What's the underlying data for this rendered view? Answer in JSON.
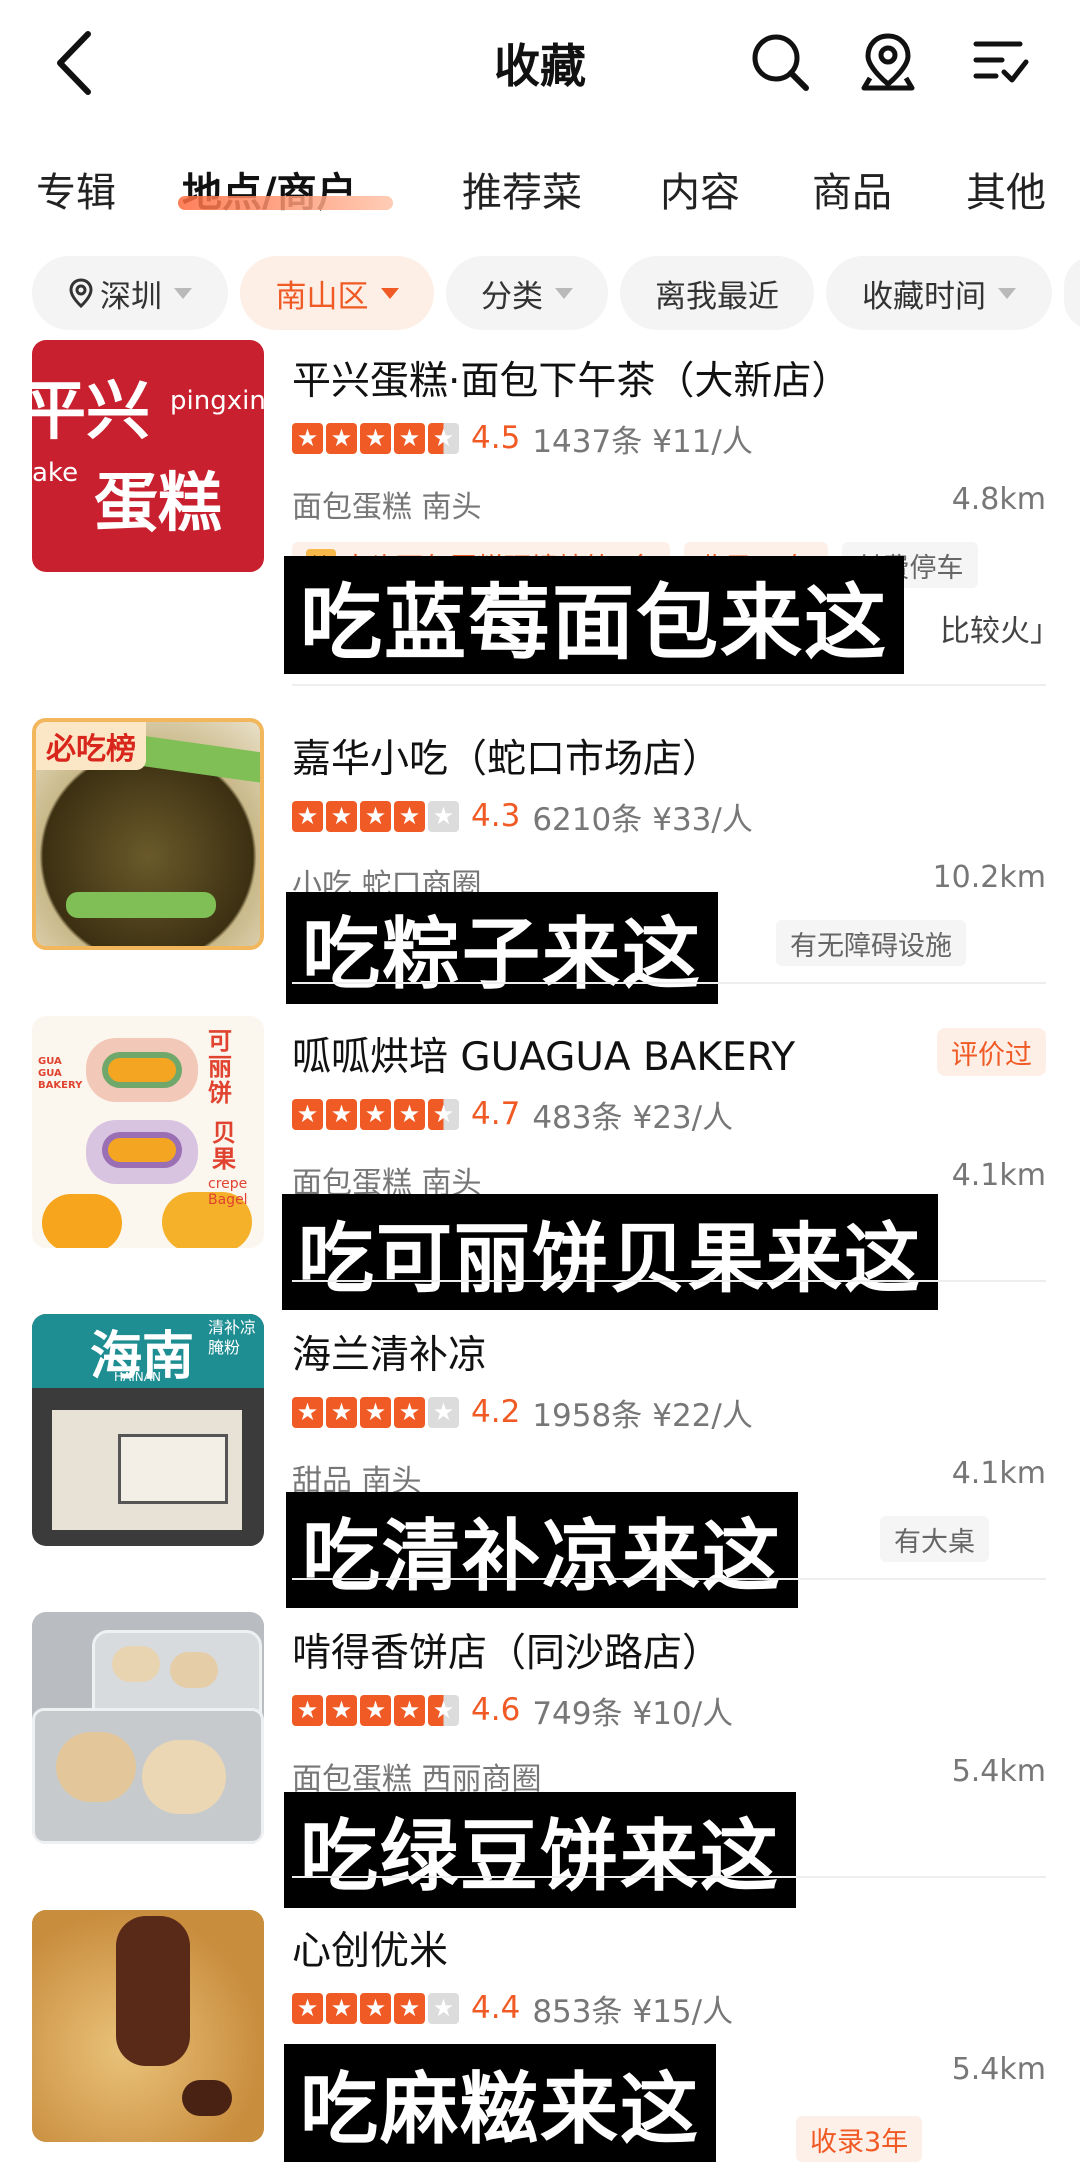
{
  "header": {
    "title": "收藏"
  },
  "tabs": [
    "专辑",
    "地点/商户",
    "推荐菜",
    "内容",
    "商品",
    "其他"
  ],
  "filters": [
    "深圳",
    "南山区",
    "分类",
    "离我最近",
    "收藏时间"
  ],
  "colors": {
    "accent": "#f05a24",
    "overlay": "#000000"
  },
  "items": [
    {
      "name": "平兴蛋糕·面包下午茶（大新店）",
      "rating": 4.5,
      "score": "4.5",
      "reviews": "1437条",
      "price": "¥11/人",
      "category": "面包蛋糕 南头",
      "distance": "4.8km",
      "tags": [
        "南头面包蛋糕环境榜第3名",
        "收录12年",
        "付费停车"
      ],
      "quote": "比较火」",
      "overlay": "吃蓝莓面包来这",
      "thumb_text": {
        "line1": "平兴",
        "line2": "蛋糕",
        "side1": "pingxin",
        "side2": "ake"
      }
    },
    {
      "name": "嘉华小吃（蛇口市场店）",
      "rating": 4.3,
      "score": "4.3",
      "reviews": "6210条",
      "price": "¥33/人",
      "category": "小吃 蛇口商圈",
      "distance": "10.2km",
      "tags": [
        "有无障碍设施"
      ],
      "overlay": "吃粽子来这",
      "thumb_text": {
        "ribbon": "必吃榜"
      }
    },
    {
      "name": "呱呱烘培 GUAGUA BAKERY",
      "badge": "评价过",
      "rating": 4.7,
      "score": "4.7",
      "reviews": "483条",
      "price": "¥23/人",
      "category": "面包蛋糕 南头",
      "distance": "4.1km",
      "overlay": "吃可丽饼贝果来这",
      "thumb_text": {
        "v1": "可丽饼",
        "v2": "贝果",
        "en1": "crepe",
        "en2": "Bagel",
        "brand": "GUA GUA BAKERY"
      }
    },
    {
      "name": "海兰清补凉",
      "rating": 4.2,
      "score": "4.2",
      "reviews": "1958条",
      "price": "¥22/人",
      "category": "甜品 南头",
      "distance": "4.1km",
      "tags": [
        "有大桌"
      ],
      "overlay": "吃清补凉来这",
      "thumb_text": {
        "sign": "海南",
        "sub": "清补凉 腌粉",
        "en": "HAINAN"
      }
    },
    {
      "name": "啃得香饼店（同沙路店）",
      "rating": 4.6,
      "score": "4.6",
      "reviews": "749条",
      "price": "¥10/人",
      "category": "面包蛋糕 西丽商圈",
      "distance": "5.4km",
      "overlay": "吃绿豆饼来这"
    },
    {
      "name": "心创优米",
      "rating": 4.4,
      "score": "4.4",
      "reviews": "853条",
      "price": "¥15/人",
      "distance": "5.4km",
      "tags": [
        "收录3年"
      ],
      "overlay": "吃麻糍来这"
    }
  ]
}
